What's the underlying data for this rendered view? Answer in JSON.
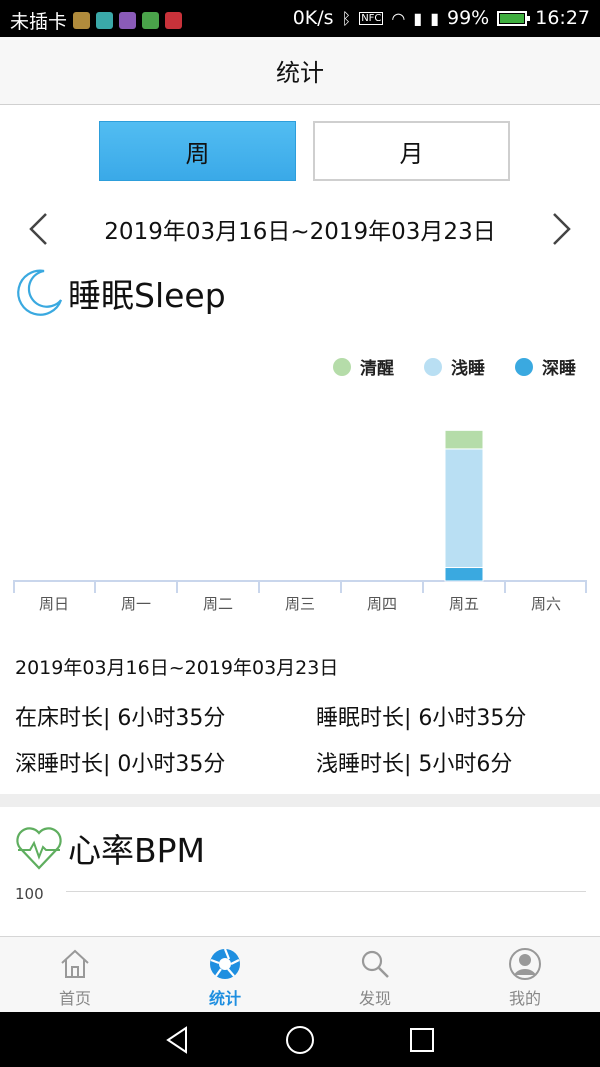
{
  "status_bar": {
    "carrier": "未插卡",
    "speed": "0K/s",
    "battery": "99%",
    "time": "16:27",
    "battery_level": 0.99,
    "icons": [
      "bluetooth-icon",
      "nfc-icon",
      "wifi-icon",
      "signal-icon",
      "battery-icon"
    ]
  },
  "header": {
    "title": "统计"
  },
  "tabs": [
    {
      "label": "周",
      "active": true
    },
    {
      "label": "月",
      "active": false
    }
  ],
  "date_nav": {
    "range": "2019年03月16日~2019年03月23日"
  },
  "sleep": {
    "title": "睡眠Sleep",
    "legend": [
      {
        "label": "清醒",
        "color": "#b5dca9"
      },
      {
        "label": "浅睡",
        "color": "#b9dff3"
      },
      {
        "label": "深睡",
        "color": "#3aa9e0"
      }
    ],
    "summary_date": "2019年03月16日~2019年03月23日",
    "stats": {
      "in_bed": "在床时长| 6小时35分",
      "asleep": "睡眠时长| 6小时35分",
      "deep": "深睡时长| 0小时35分",
      "light": "浅睡时长| 5小时6分"
    }
  },
  "chart_data": {
    "type": "bar",
    "stacked": true,
    "categories": [
      "周日",
      "周一",
      "周二",
      "周三",
      "周四",
      "周五",
      "周六"
    ],
    "series": [
      {
        "name": "深睡",
        "values": [
          0,
          0,
          0,
          0,
          0,
          0.58,
          0
        ],
        "color": "#3aa9e0"
      },
      {
        "name": "浅睡",
        "values": [
          0,
          0,
          0,
          0,
          0,
          5.1,
          0
        ],
        "color": "#b9dff3"
      },
      {
        "name": "清醒",
        "values": [
          0,
          0,
          0,
          0,
          0,
          0.8,
          0
        ],
        "color": "#b5dca9"
      }
    ],
    "ylim": [
      0,
      8
    ],
    "legend_position": "top-right",
    "grid": false
  },
  "bpm": {
    "title": "心率BPM",
    "y_label": "100"
  },
  "bottom_nav": [
    {
      "label": "首页",
      "icon": "home-icon",
      "active": false
    },
    {
      "label": "统计",
      "icon": "stats-shutter-icon",
      "active": true
    },
    {
      "label": "发现",
      "icon": "search-icon",
      "active": false
    },
    {
      "label": "我的",
      "icon": "user-icon",
      "active": false
    }
  ],
  "colors": {
    "accent": "#3aa9e8",
    "active_nav": "#1f8fe0"
  }
}
